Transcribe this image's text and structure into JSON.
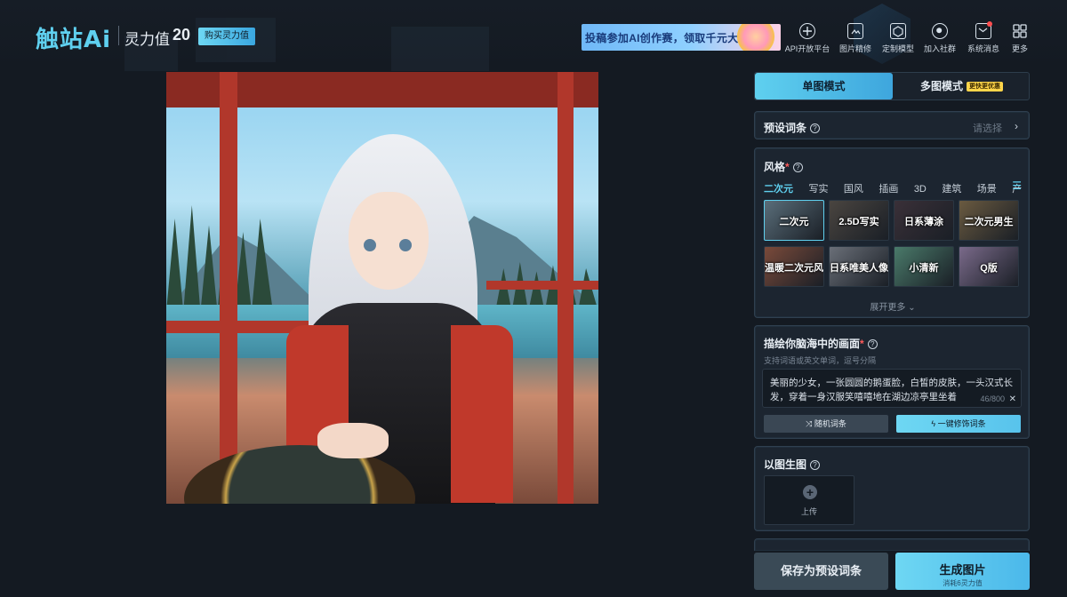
{
  "header": {
    "logo": "触站Ai",
    "power_label": "灵力值",
    "power_value": "20",
    "buy_button": "购买灵力值",
    "banner_text": "投稿参加AI创作赛，领取千元大奖"
  },
  "nav": [
    {
      "icon": "api-platform-icon",
      "label": "API开放平台"
    },
    {
      "icon": "image-refine-icon",
      "label": "图片精修"
    },
    {
      "icon": "custom-model-icon",
      "label": "定制模型"
    },
    {
      "icon": "join-community-icon",
      "label": "加入社群"
    },
    {
      "icon": "message-icon",
      "label": "系统消息"
    },
    {
      "icon": "more-icon",
      "label": "更多"
    }
  ],
  "mode_tabs": {
    "single": "单图模式",
    "multi": "多图模式",
    "multi_badge": "更快更优惠"
  },
  "preset": {
    "title": "预设词条",
    "placeholder": "请选择"
  },
  "style": {
    "title": "风格",
    "tabs": [
      "二次元",
      "写实",
      "国风",
      "插画",
      "3D",
      "建筑",
      "场景",
      "产品设计"
    ],
    "thumbs": [
      "二次元",
      "2.5D写实",
      "日系薄涂",
      "二次元男生",
      "温暖二次元风",
      "日系唯美人像",
      "小清新",
      "Q版"
    ],
    "thumb_colors": [
      "#5a6e7a",
      "#4a4540",
      "#3a3038",
      "#6a5a40",
      "#7a4a3a",
      "#6a6f78",
      "#4a7a6a",
      "#7a6a8a"
    ],
    "expand": "展开更多"
  },
  "prompt": {
    "title": "描绘你脑海中的画面",
    "subtitle": "支持词语或英文单词，逗号分隔",
    "text": "美丽的少女，一张圆圆的鹅蛋脸，白皙的皮肤，一头汉式长发，穿着一身汉服笑嘻嘻地在湖边凉亭里坐着",
    "count": "46/800",
    "random_button": "随机词条",
    "polish_button": "一键修饰词条"
  },
  "img2img": {
    "title": "以图生图",
    "upload_label": "上传"
  },
  "actions": {
    "save_preset": "保存为预设词条",
    "generate": "生成图片",
    "generate_cost": "消耗6灵力值"
  },
  "colors": {
    "accent": "#5fd0ef",
    "background": "#141a22",
    "card": "#1c2530",
    "badge": "#ffd54a"
  }
}
